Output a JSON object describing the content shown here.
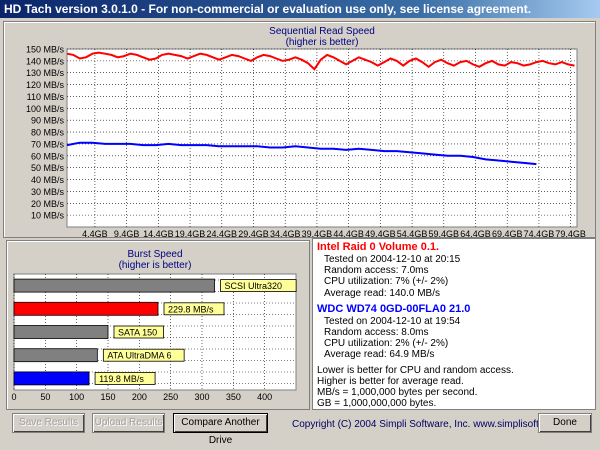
{
  "window": {
    "title": "HD Tach version 3.0.1.0  - For non-commercial or evaluation use only, see license agreement."
  },
  "colors": {
    "drive1": "#ff0000",
    "drive2": "#0000ff",
    "scsi": "#808080",
    "gridline": "#000000"
  },
  "chart_data": [
    {
      "type": "line",
      "title": "Sequential Read Speed",
      "subtitle": "(higher is better)",
      "yunit": "MB/s",
      "ylim": [
        0,
        150
      ],
      "yticks": [
        150,
        140,
        130,
        120,
        110,
        100,
        90,
        80,
        70,
        60,
        50,
        40,
        30,
        20,
        10
      ],
      "xlim": [
        0,
        80.4
      ],
      "xticks": [
        "4.4GB",
        "9.4GB",
        "14.4GB",
        "19.4GB",
        "24.4GB",
        "29.4GB",
        "34.4GB",
        "39.4GB",
        "44.4GB",
        "49.4GB",
        "54.4GB",
        "59.4GB",
        "64.4GB",
        "69.4GB",
        "74.4GB",
        "79.4GB"
      ],
      "grid": true,
      "series": [
        {
          "name": "Intel Raid 0 Volume 0.1.",
          "color": "#ff0000",
          "x": [
            0,
            1,
            2,
            3,
            4,
            5,
            6,
            7,
            8,
            9,
            10,
            11,
            12,
            13,
            14,
            15,
            16,
            17,
            18,
            19,
            20,
            21,
            22,
            23,
            24,
            25,
            26,
            27,
            28,
            29,
            30,
            31,
            32,
            33,
            34,
            35,
            36,
            37,
            38,
            39,
            40,
            41,
            42,
            43,
            44,
            45,
            46,
            47,
            48,
            49,
            50,
            51,
            52,
            53,
            54,
            55,
            56,
            57,
            58,
            59,
            60,
            61,
            62,
            63,
            64,
            65,
            66,
            67,
            68,
            69,
            70,
            71,
            72,
            73,
            74,
            75,
            76,
            77,
            78,
            79,
            80
          ],
          "y": [
            146,
            145,
            142,
            143,
            146,
            147,
            146,
            145,
            143,
            144,
            146,
            145,
            143,
            141,
            142,
            145,
            146,
            145,
            144,
            142,
            144,
            146,
            145,
            143,
            141,
            143,
            145,
            144,
            142,
            140,
            143,
            145,
            144,
            142,
            140,
            141,
            143,
            141,
            138,
            133,
            141,
            145,
            143,
            140,
            137,
            140,
            143,
            141,
            139,
            136,
            139,
            142,
            140,
            136,
            140,
            142,
            139,
            135,
            139,
            141,
            138,
            136,
            139,
            140,
            137,
            135,
            138,
            140,
            137,
            136,
            139,
            138,
            136,
            137,
            139,
            140,
            138,
            137,
            139,
            137,
            136
          ]
        },
        {
          "name": "WDC WD74 0GD-00FLA0 21.0",
          "color": "#0000ff",
          "x": [
            0,
            2,
            4,
            6,
            8,
            10,
            12,
            14,
            16,
            18,
            20,
            22,
            24,
            26,
            28,
            30,
            32,
            34,
            36,
            38,
            40,
            42,
            44,
            46,
            48,
            50,
            52,
            54,
            56,
            58,
            60,
            62,
            64,
            66,
            68,
            70,
            72,
            74
          ],
          "y": [
            69,
            71,
            71,
            70,
            70,
            70,
            69,
            69,
            70,
            69,
            69,
            69,
            68,
            68,
            68,
            68,
            67,
            67,
            68,
            67,
            66,
            66,
            65,
            66,
            65,
            64,
            64,
            63,
            62,
            61,
            60,
            60,
            59,
            57,
            56,
            55,
            54,
            53
          ]
        }
      ]
    },
    {
      "type": "bar",
      "orientation": "horizontal",
      "title": "Burst Speed",
      "subtitle": "(higher is better)",
      "xlim": [
        0,
        450
      ],
      "xticks": [
        0,
        50,
        100,
        150,
        200,
        250,
        300,
        350,
        400
      ],
      "bars": [
        {
          "label": "SCSI Ultra320",
          "value": 320,
          "color": "#808080"
        },
        {
          "label": "229.8 MB/s",
          "value": 229.8,
          "color": "#ff0000"
        },
        {
          "label": "SATA 150",
          "value": 150,
          "color": "#808080"
        },
        {
          "label": "ATA UltraDMA 6",
          "value": 133,
          "color": "#808080"
        },
        {
          "label": "119.8 MB/s",
          "value": 119.8,
          "color": "#0000ff"
        }
      ]
    }
  ],
  "info": {
    "drive1": {
      "name": "Intel Raid 0 Volume 0.1.",
      "tested": "Tested on 2004-12-10 at 20:15",
      "random": "Random access: 7.0ms",
      "cpu": "CPU utilization: 7% (+/- 2%)",
      "average": "Average read: 140.0 MB/s"
    },
    "drive2": {
      "name": "WDC WD74 0GD-00FLA0 21.0",
      "tested": "Tested on 2004-12-10 at 19:54",
      "random": "Random access: 8.0ms",
      "cpu": "CPU utilization: 2% (+/- 2%)",
      "average": "Average read: 64.9 MB/s"
    },
    "notes": [
      "Lower is better for CPU and random access.",
      "Higher is better for average read.",
      "MB/s = 1,000,000 bytes per second.",
      "GB = 1,000,000,000 bytes."
    ]
  },
  "buttons": {
    "save": "Save Results",
    "upload": "Upload Results",
    "compare": "Compare Another Drive",
    "done": "Done"
  },
  "footer": {
    "copyright": "Copyright (C) 2004 Simpli Software, Inc.",
    "url": "www.simplisoftware.com"
  }
}
